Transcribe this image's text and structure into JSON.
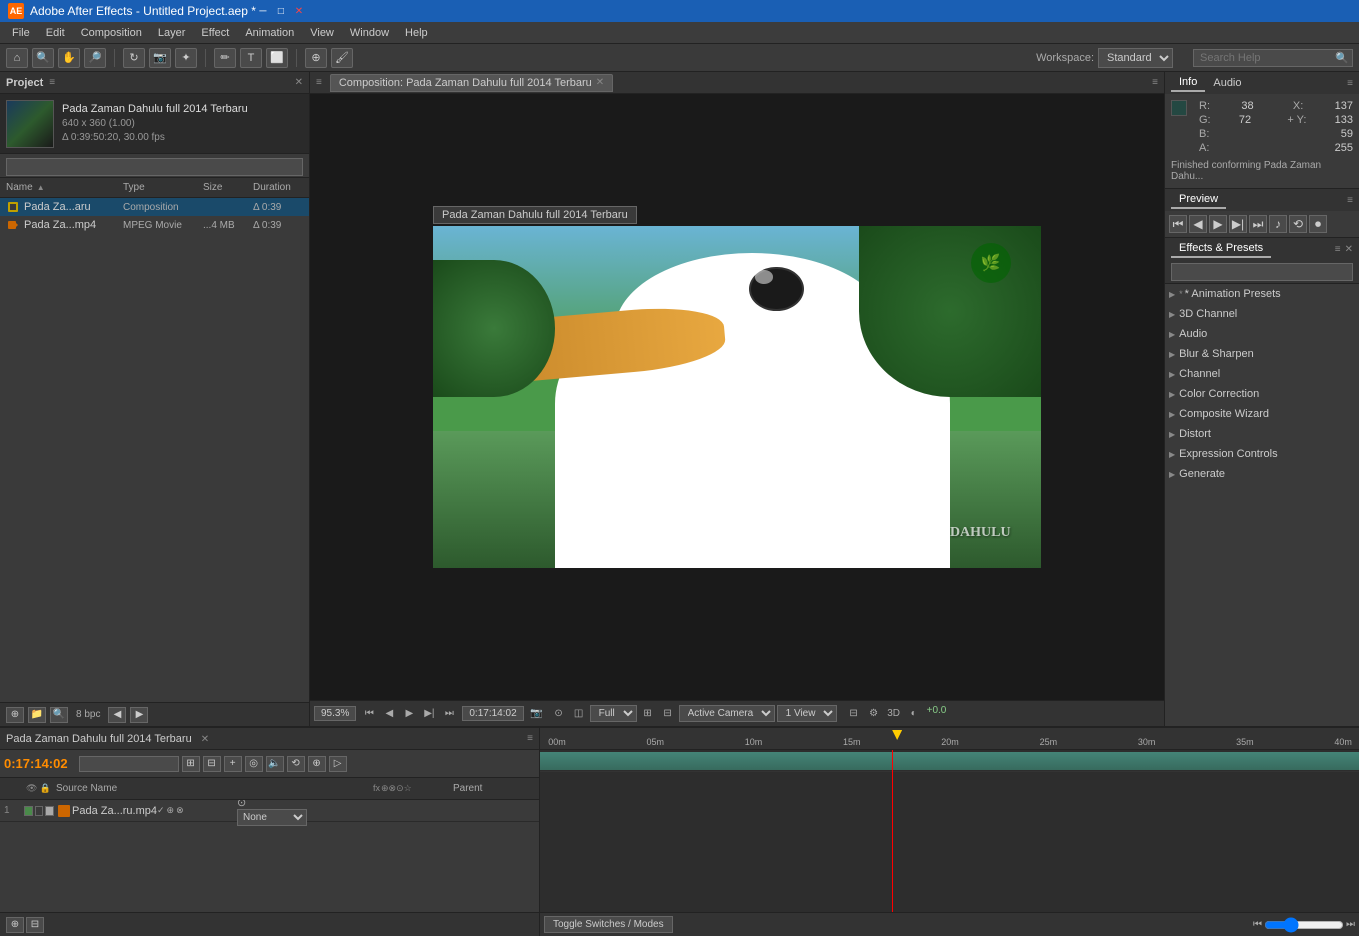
{
  "titlebar": {
    "icon": "AE",
    "title": "Adobe After Effects - Untitled Project.aep *",
    "min_btn": "─",
    "max_btn": "□",
    "close_btn": "✕"
  },
  "menubar": {
    "items": [
      "File",
      "Edit",
      "Composition",
      "Layer",
      "Effect",
      "Animation",
      "View",
      "Window",
      "Help"
    ]
  },
  "toolbar": {
    "workspace_label": "Workspace:",
    "workspace_value": "Standard",
    "search_placeholder": "Search Help"
  },
  "project": {
    "panel_title": "Project",
    "composition_name": "Pada Zaman Dahulu full 2014 Terbaru",
    "resolution": "640 x 360 (1.00)",
    "duration": "Δ 0:39:50:20, 30.00 fps",
    "search_placeholder": "",
    "columns": {
      "name": "Name",
      "type": "Type",
      "size": "Size",
      "duration": "Duration"
    },
    "items": [
      {
        "name": "Pada Za...aru",
        "icon": "🎬",
        "type": "Composition",
        "size": "",
        "duration": "Δ 0:39"
      },
      {
        "name": "Pada Za...mp4",
        "icon": "🎥",
        "type": "MPEG Movie",
        "size": "...4 MB",
        "duration": "Δ 0:39"
      }
    ],
    "footer": {
      "bit_depth": "8 bpc"
    }
  },
  "composition": {
    "tab_label": "Composition: Pada Zaman Dahulu full 2014 Terbaru",
    "frame_label": "Pada Zaman Dahulu full 2014 Terbaru",
    "zoom": "95.3%",
    "timecode": "0:17:14:02",
    "view_quality": "Full",
    "active_camera": "Active Camera",
    "view_mode": "1 View",
    "green_value": "+0.0",
    "watermark": "DAHULU"
  },
  "info_panel": {
    "title": "Info",
    "audio_tab": "Audio",
    "r_label": "R:",
    "r_value": "38",
    "x_label": "X:",
    "x_value": "137",
    "g_label": "G:",
    "g_value": "72",
    "y_label": "+ Y:",
    "y_value": "133",
    "b_label": "B:",
    "b_value": "59",
    "a_label": "A:",
    "a_value": "255",
    "message": "Finished conforming Pada Zaman Dahu..."
  },
  "preview_panel": {
    "title": "Preview"
  },
  "effects_panel": {
    "title": "Effects & Presets",
    "search_placeholder": "",
    "categories": [
      "* Animation Presets",
      "3D Channel",
      "Audio",
      "Blur & Sharpen",
      "Channel",
      "Color Correction",
      "Composite Wizard",
      "Distort",
      "Expression Controls",
      "Generate"
    ]
  },
  "timeline": {
    "tab_label": "Pada Zaman Dahulu full 2014 Terbaru",
    "timecode": "0:17:14:02",
    "columns": {
      "source_name": "Source Name",
      "switches": "Switches",
      "parent": "Parent"
    },
    "layers": [
      {
        "num": "1",
        "name": "Pada Za...ru.mp4",
        "parent": "None"
      }
    ],
    "ruler_marks": [
      "00m",
      "05m",
      "10m",
      "15m",
      "20m",
      "25m",
      "30m",
      "35m",
      "40m"
    ],
    "toggle_switches_label": "Toggle Switches / Modes",
    "playhead_position": "63%"
  }
}
